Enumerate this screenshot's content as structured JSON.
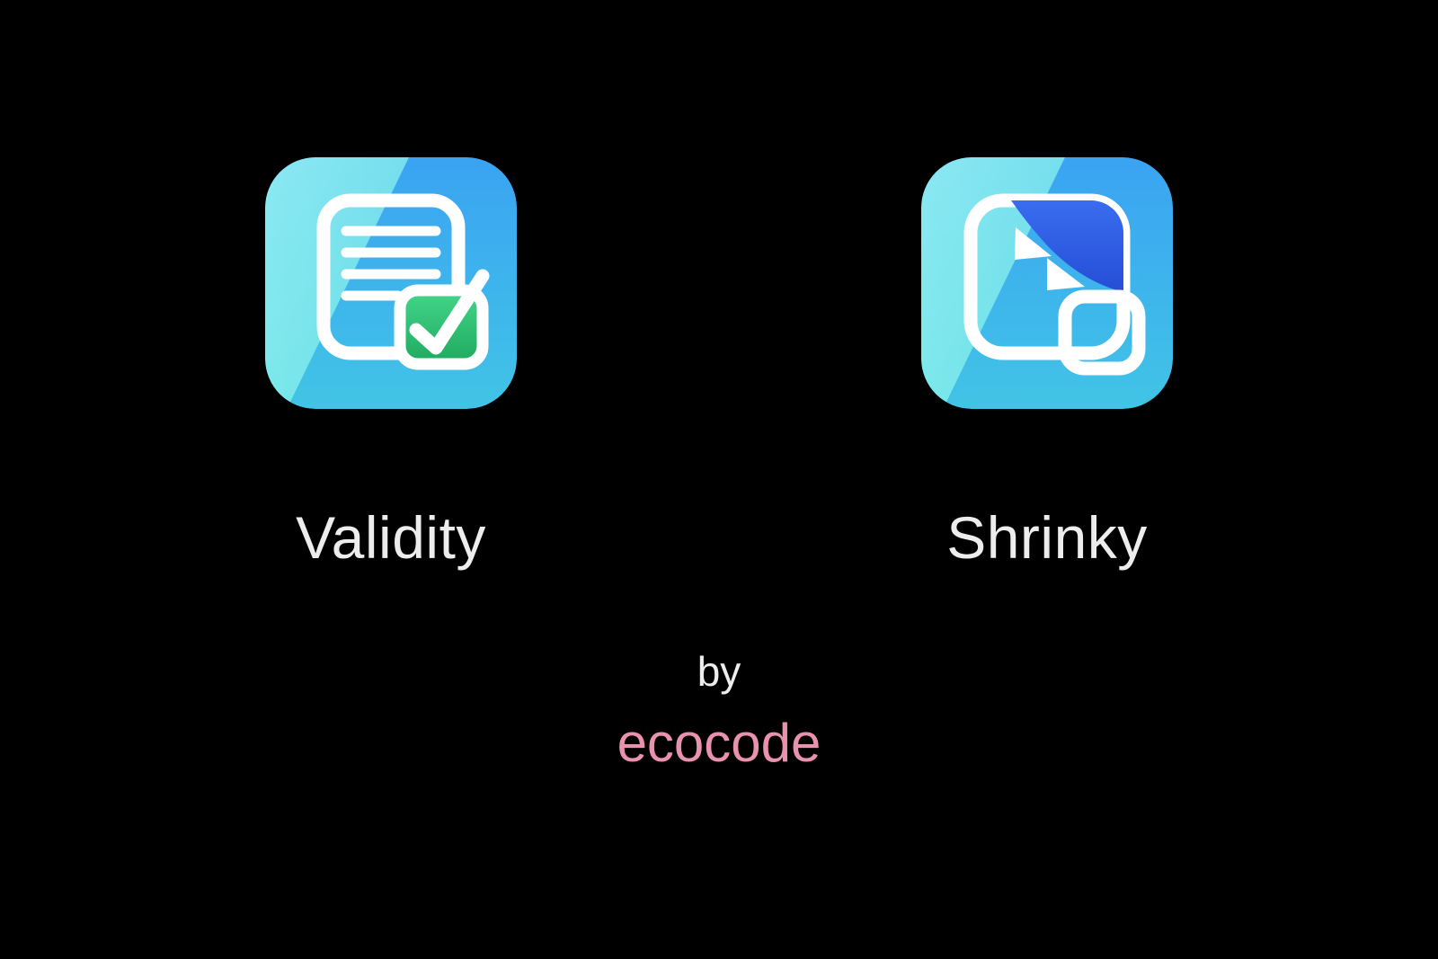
{
  "apps": [
    {
      "label": "Validity"
    },
    {
      "label": "Shrinky"
    }
  ],
  "credit": {
    "by": "by",
    "name": "ecocode"
  },
  "colors": {
    "background": "#000000",
    "text": "#ededed",
    "credit_accent": "#e892ae",
    "icon_bg_top": "#46baff",
    "icon_bg_bottom": "#3fb6e6",
    "icon_highlight": "#88f0ee",
    "check_green": "#29bd6e",
    "check_green_top": "#44d68a",
    "blue_fill": "#2c5fe3"
  }
}
